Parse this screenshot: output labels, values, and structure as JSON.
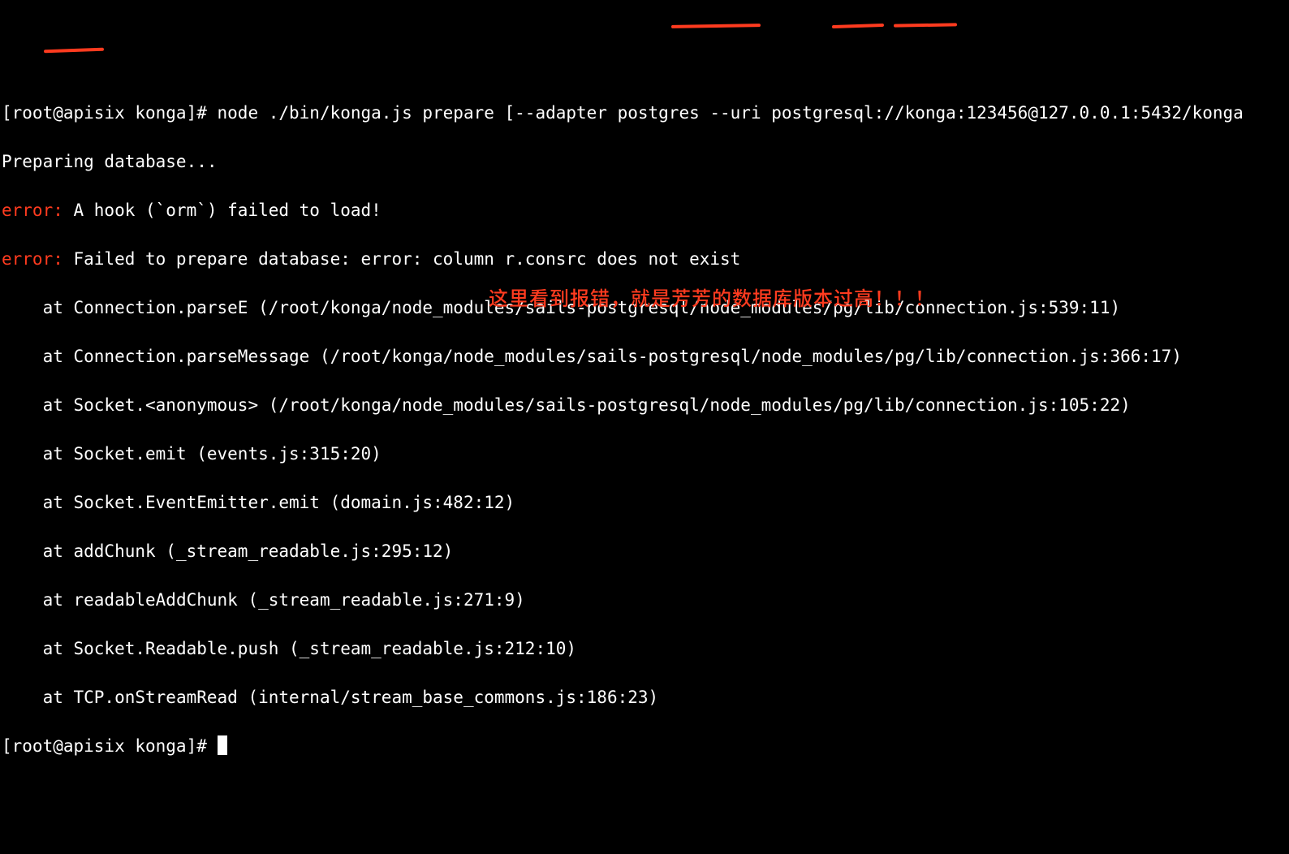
{
  "prompt": "[root@apisix konga]# ",
  "command": "node ./bin/konga.js prepare [--adapter postgres --uri postgresql://konga:123456@127.0.0.1:5432/konga",
  "preparing": "Preparing database...",
  "error_label": "error:",
  "err1_msg": " A hook (`orm`) failed to load!",
  "err2_msg": " Failed to prepare database: error: column r.consrc does not exist",
  "stack": [
    "    at Connection.parseE (/root/konga/node_modules/sails-postgresql/node_modules/pg/lib/connection.js:539:11)",
    "    at Connection.parseMessage (/root/konga/node_modules/sails-postgresql/node_modules/pg/lib/connection.js:366:17)",
    "    at Socket.<anonymous> (/root/konga/node_modules/sails-postgresql/node_modules/pg/lib/connection.js:105:22)",
    "    at Socket.emit (events.js:315:20)",
    "    at Socket.EventEmitter.emit (domain.js:482:12)",
    "    at addChunk (_stream_readable.js:295:12)",
    "    at readableAddChunk (_stream_readable.js:271:9)",
    "    at Socket.Readable.push (_stream_readable.js:212:10)",
    "    at TCP.onStreamRead (internal/stream_base_commons.js:186:23)"
  ],
  "annotation": "这里看到报错，就是芳芳的数据库版本过高！！！",
  "prompt2": "[root@apisix konga]# "
}
